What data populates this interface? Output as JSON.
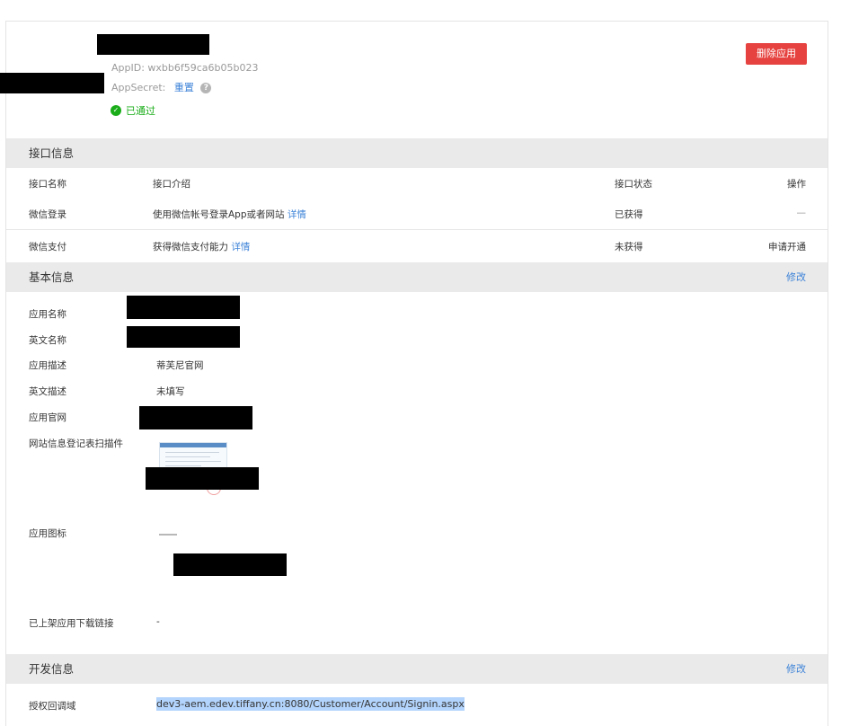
{
  "app": {
    "app_id_label": "AppID:",
    "app_id_value": "wxbb6f59ca6b05b023",
    "app_secret_label": "AppSecret:",
    "app_secret_reset": "重置",
    "status": "已通过",
    "delete_button": "删除应用"
  },
  "interface_section": {
    "title": "接口信息",
    "headers": {
      "name": "接口名称",
      "intro": "接口介绍",
      "state": "接口状态",
      "op": "操作"
    },
    "rows": [
      {
        "name": "微信登录",
        "intro": "使用微信帐号登录App或者网站",
        "detail": "详情",
        "state": "已获得",
        "op": "—"
      },
      {
        "name": "微信支付",
        "intro": "获得微信支付能力",
        "detail": "详情",
        "state": "未获得",
        "op": "申请开通"
      }
    ]
  },
  "basic_section": {
    "title": "基本信息",
    "edit": "修改",
    "labels": {
      "app_name": "应用名称",
      "en_name": "英文名称",
      "app_desc": "应用描述",
      "en_desc": "英文描述",
      "website": "应用官网",
      "reg_form": "网站信息登记表扫描件",
      "app_icon": "应用图标",
      "download_link": "已上架应用下载链接"
    },
    "values": {
      "app_desc": "蒂芙尼官网",
      "en_desc": "未填写",
      "download_link": "-"
    }
  },
  "dev_section": {
    "title": "开发信息",
    "edit": "修改",
    "callback_label": "授权回调域",
    "callback_value": "dev3-aem.edev.tiffany.cn:8080/Customer/Account/Signin.aspx"
  },
  "colors": {
    "link": "#3d83d8",
    "danger": "#e64340",
    "success": "#1aad19",
    "section_bg": "#eaeaea"
  }
}
